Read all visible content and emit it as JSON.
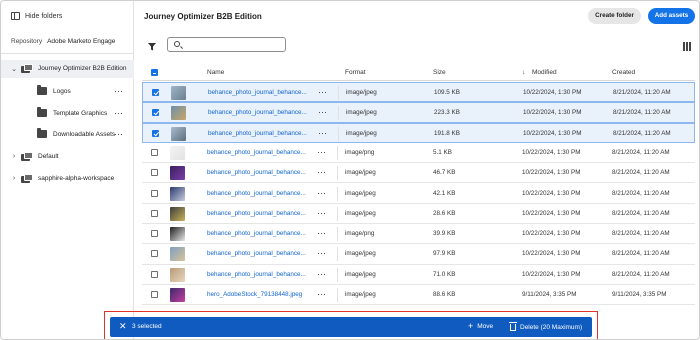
{
  "sidebar": {
    "hide_folders_label": "Hide folders",
    "repository_label": "Repository",
    "repository_value": "Adobe Marketo Engage",
    "tree": {
      "root": "Journey Optimizer B2B Edition",
      "children": [
        "Logos",
        "Template Graphics",
        "Downloadable Assets"
      ],
      "siblings": [
        "Default",
        "sapphire-alpha-workspace"
      ]
    }
  },
  "header": {
    "title": "Journey Optimizer B2B Edition",
    "create_folder": "Create folder",
    "add_assets": "Add assets",
    "search_placeholder": ""
  },
  "table": {
    "columns": [
      "Name",
      "Format",
      "Size",
      "Modified",
      "Created"
    ],
    "sort_indicator": "↓",
    "rows": [
      {
        "name": "behance_photo_journal_behance...",
        "format": "image/jpeg",
        "size": "109.5 KB",
        "modified": "10/22/2024, 1:30 PM",
        "created": "8/21/2024, 11:20 AM",
        "selected": true,
        "thumb": [
          "#9fb6c9",
          "#6b7f8d"
        ]
      },
      {
        "name": "behance_photo_journal_behance...",
        "format": "image/jpeg",
        "size": "223.3 KB",
        "modified": "10/22/2024, 1:30 PM",
        "created": "8/21/2024, 11:20 AM",
        "selected": true,
        "thumb": [
          "#6d8fa8",
          "#c9a66b"
        ]
      },
      {
        "name": "behance_photo_journal_behance...",
        "format": "image/jpeg",
        "size": "191.8 KB",
        "modified": "10/22/2024, 1:30 PM",
        "created": "8/21/2024, 11:20 AM",
        "selected": true,
        "thumb": [
          "#a8bcd0",
          "#5e6e7a"
        ]
      },
      {
        "name": "behance_photo_journal_behance...",
        "format": "image/png",
        "size": "5.1 KB",
        "modified": "10/22/2024, 1:30 PM",
        "created": "8/21/2024, 11:20 AM",
        "selected": false,
        "thumb": [
          "#f4f4f4",
          "#e2e2e2"
        ]
      },
      {
        "name": "behance_photo_journal_behance...",
        "format": "image/jpeg",
        "size": "46.7 KB",
        "modified": "10/22/2024, 1:30 PM",
        "created": "8/21/2024, 11:20 AM",
        "selected": false,
        "thumb": [
          "#3a1f5e",
          "#7a3fa8"
        ]
      },
      {
        "name": "behance_photo_journal_behance...",
        "format": "image/jpeg",
        "size": "42.1 KB",
        "modified": "10/22/2024, 1:30 PM",
        "created": "8/21/2024, 11:20 AM",
        "selected": false,
        "thumb": [
          "#2b3a6e",
          "#c8cbe0"
        ]
      },
      {
        "name": "behance_photo_journal_behance...",
        "format": "image/jpeg",
        "size": "28.6 KB",
        "modified": "10/22/2024, 1:30 PM",
        "created": "8/21/2024, 11:20 AM",
        "selected": false,
        "thumb": [
          "#3c3c3c",
          "#c9b45a"
        ]
      },
      {
        "name": "behance_photo_journal_behance...",
        "format": "image/png",
        "size": "39.9 KB",
        "modified": "10/22/2024, 1:30 PM",
        "created": "8/21/2024, 11:20 AM",
        "selected": false,
        "thumb": [
          "#1e1e1e",
          "#e8e8e8"
        ]
      },
      {
        "name": "behance_photo_journal_behance...",
        "format": "image/jpeg",
        "size": "97.9 KB",
        "modified": "10/22/2024, 1:30 PM",
        "created": "8/21/2024, 11:20 AM",
        "selected": false,
        "thumb": [
          "#7ea0c2",
          "#d9c29a"
        ]
      },
      {
        "name": "behance_photo_journal_behance...",
        "format": "image/jpeg",
        "size": "71.0 KB",
        "modified": "10/22/2024, 1:30 PM",
        "created": "8/21/2024, 11:20 AM",
        "selected": false,
        "thumb": [
          "#b89a78",
          "#e8d7c0"
        ]
      },
      {
        "name": "hero_AdobeStock_79138448.jpeg",
        "format": "image/jpeg",
        "size": "88.6 KB",
        "modified": "9/11/2024, 3:35 PM",
        "created": "9/11/2024, 3:35 PM",
        "selected": false,
        "thumb": [
          "#3a2a6a",
          "#c43fa0"
        ]
      }
    ]
  },
  "action_bar": {
    "close_glyph": "✕",
    "selected_text": "3 selected",
    "move_label": "Move",
    "delete_label": "Delete (20 Maximum)",
    "bar_color": "#0f5bbf"
  }
}
